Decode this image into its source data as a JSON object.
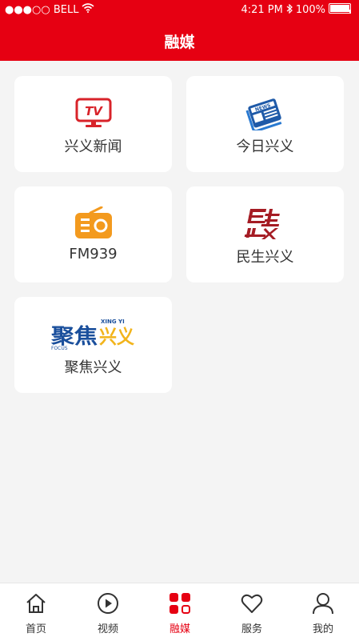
{
  "status_bar": {
    "carrier": "●●●○○ BELL",
    "time": "4:21 PM",
    "battery": "100%"
  },
  "header": {
    "title": "融媒"
  },
  "cards": [
    {
      "label": "兴义新闻",
      "icon": "tv-icon",
      "logo_text": "TV"
    },
    {
      "label": "今日兴义",
      "icon": "newspaper-icon",
      "logo_text": "NEWS"
    },
    {
      "label": "FM939",
      "icon": "radio-icon"
    },
    {
      "label": "民生兴义",
      "icon": "minsheng-logo-icon"
    },
    {
      "label": "聚焦兴义",
      "icon": "jujiao-logo-icon",
      "logo_text": "聚焦兴义",
      "logo_sub_top": "XING YI",
      "logo_sub_bottom": "FOCUS"
    }
  ],
  "tabbar": {
    "items": [
      {
        "label": "首页",
        "icon": "home-icon"
      },
      {
        "label": "视频",
        "icon": "play-icon"
      },
      {
        "label": "融媒",
        "icon": "grid-icon",
        "active": true
      },
      {
        "label": "服务",
        "icon": "heart-icon"
      },
      {
        "label": "我的",
        "icon": "user-icon"
      }
    ]
  },
  "colors": {
    "brand": "#e60012",
    "card_icon_red": "#d8232a",
    "radio_orange": "#f39a1e",
    "news_blue": "#1f5aa8",
    "focus_blue": "#1a4f9c",
    "focus_yellow": "#f2b41b"
  }
}
